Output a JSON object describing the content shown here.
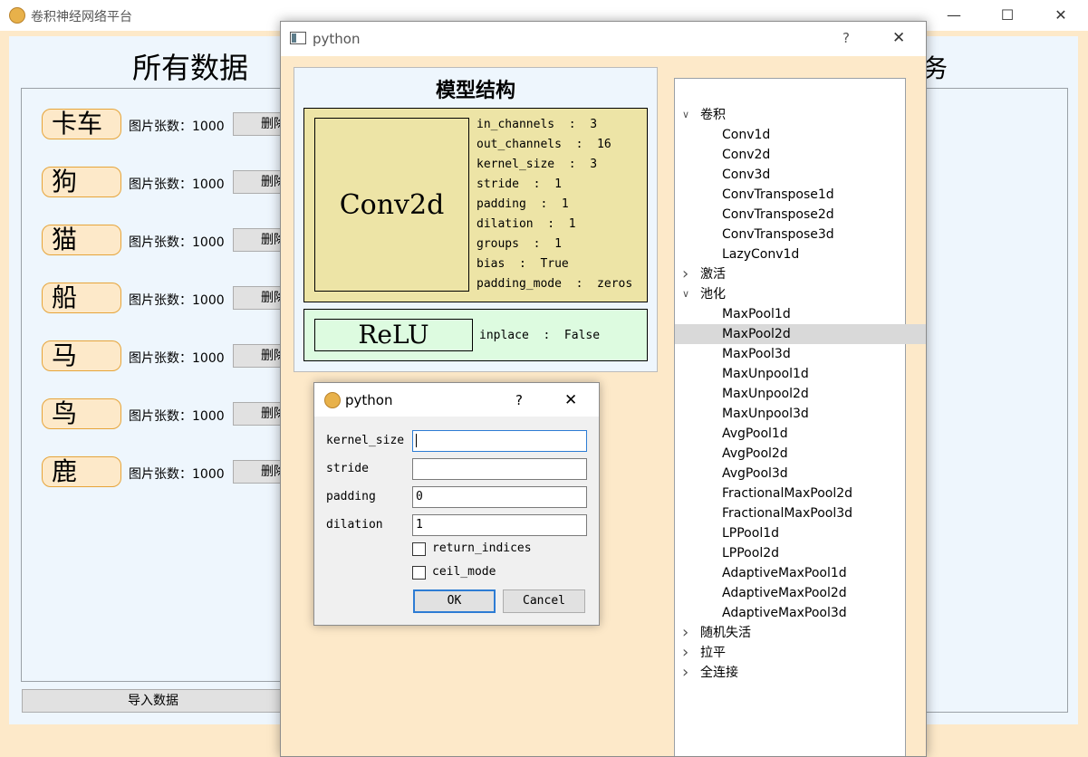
{
  "main_window": {
    "title": "卷积神经网络平台",
    "controls": {
      "minimize": "—",
      "maximize": "☐",
      "close": "✕"
    }
  },
  "data_section": {
    "title": "所有数据",
    "items": [
      {
        "label": "卡车",
        "count_text": "图片张数：1000",
        "delete_label": "删除"
      },
      {
        "label": "狗",
        "count_text": "图片张数：1000",
        "delete_label": "删除"
      },
      {
        "label": "猫",
        "count_text": "图片张数：1000",
        "delete_label": "删除"
      },
      {
        "label": "船",
        "count_text": "图片张数：1000",
        "delete_label": "删除"
      },
      {
        "label": "马",
        "count_text": "图片张数：1000",
        "delete_label": "删除"
      },
      {
        "label": "鸟",
        "count_text": "图片张数：1000",
        "delete_label": "删除"
      },
      {
        "label": "鹿",
        "count_text": "图片张数：1000",
        "delete_label": "删除"
      }
    ],
    "import_button": "导入数据"
  },
  "right_section": {
    "title_fragment": "务"
  },
  "model_window": {
    "title": "python",
    "help": "?",
    "close": "✕",
    "structure_title": "模型结构",
    "layers": {
      "conv": {
        "name": "Conv2d",
        "params": [
          "in_channels  :  3",
          "out_channels  :  16",
          "kernel_size  :  3",
          "stride  :  1",
          "padding  :  1",
          "dilation  :  1",
          "groups  :  1",
          "bias  :  True",
          "padding_mode  :  zeros"
        ]
      },
      "relu": {
        "name": "ReLU",
        "param": "inplace  :  False"
      }
    },
    "tree": [
      {
        "label": "卷积",
        "kind": "cat",
        "expanded": true
      },
      {
        "label": "Conv1d",
        "kind": "leaf"
      },
      {
        "label": "Conv2d",
        "kind": "leaf"
      },
      {
        "label": "Conv3d",
        "kind": "leaf"
      },
      {
        "label": "ConvTranspose1d",
        "kind": "leaf"
      },
      {
        "label": "ConvTranspose2d",
        "kind": "leaf"
      },
      {
        "label": "ConvTranspose3d",
        "kind": "leaf"
      },
      {
        "label": "LazyConv1d",
        "kind": "leaf"
      },
      {
        "label": "激活",
        "kind": "cat",
        "expanded": false
      },
      {
        "label": "池化",
        "kind": "cat",
        "expanded": true
      },
      {
        "label": "MaxPool1d",
        "kind": "leaf"
      },
      {
        "label": "MaxPool2d",
        "kind": "leaf",
        "selected": true
      },
      {
        "label": "MaxPool3d",
        "kind": "leaf"
      },
      {
        "label": "MaxUnpool1d",
        "kind": "leaf"
      },
      {
        "label": "MaxUnpool2d",
        "kind": "leaf"
      },
      {
        "label": "MaxUnpool3d",
        "kind": "leaf"
      },
      {
        "label": "AvgPool1d",
        "kind": "leaf"
      },
      {
        "label": "AvgPool2d",
        "kind": "leaf"
      },
      {
        "label": "AvgPool3d",
        "kind": "leaf"
      },
      {
        "label": "FractionalMaxPool2d",
        "kind": "leaf"
      },
      {
        "label": "FractionalMaxPool3d",
        "kind": "leaf"
      },
      {
        "label": "LPPool1d",
        "kind": "leaf"
      },
      {
        "label": "LPPool2d",
        "kind": "leaf"
      },
      {
        "label": "AdaptiveMaxPool1d",
        "kind": "leaf"
      },
      {
        "label": "AdaptiveMaxPool2d",
        "kind": "leaf"
      },
      {
        "label": "AdaptiveMaxPool3d",
        "kind": "leaf"
      },
      {
        "label": "随机失活",
        "kind": "cat",
        "expanded": false
      },
      {
        "label": "拉平",
        "kind": "cat",
        "expanded": false
      },
      {
        "label": "全连接",
        "kind": "cat",
        "expanded": false
      }
    ]
  },
  "dialog": {
    "title": "python",
    "help": "?",
    "close": "✕",
    "fields": [
      {
        "label": "kernel_size",
        "value": "",
        "focused": true
      },
      {
        "label": "stride",
        "value": ""
      },
      {
        "label": "padding",
        "value": "0"
      },
      {
        "label": "dilation",
        "value": "1"
      }
    ],
    "checkboxes": [
      {
        "label": "return_indices",
        "checked": false
      },
      {
        "label": "ceil_mode",
        "checked": false
      }
    ],
    "ok_label": "OK",
    "cancel_label": "Cancel"
  },
  "colors": {
    "window_bg": "#fde9c9",
    "panel_bg": "#eef6fd",
    "conv_block": "#ede4a6",
    "relu_block": "#ddfbe0",
    "label_border": "#e6a43a",
    "focus": "#2d7cd4"
  },
  "icons": [
    "app-doge-icon",
    "window-icon",
    "dialog-doge-icon",
    "chevron-right-icon",
    "chevron-down-icon"
  ]
}
